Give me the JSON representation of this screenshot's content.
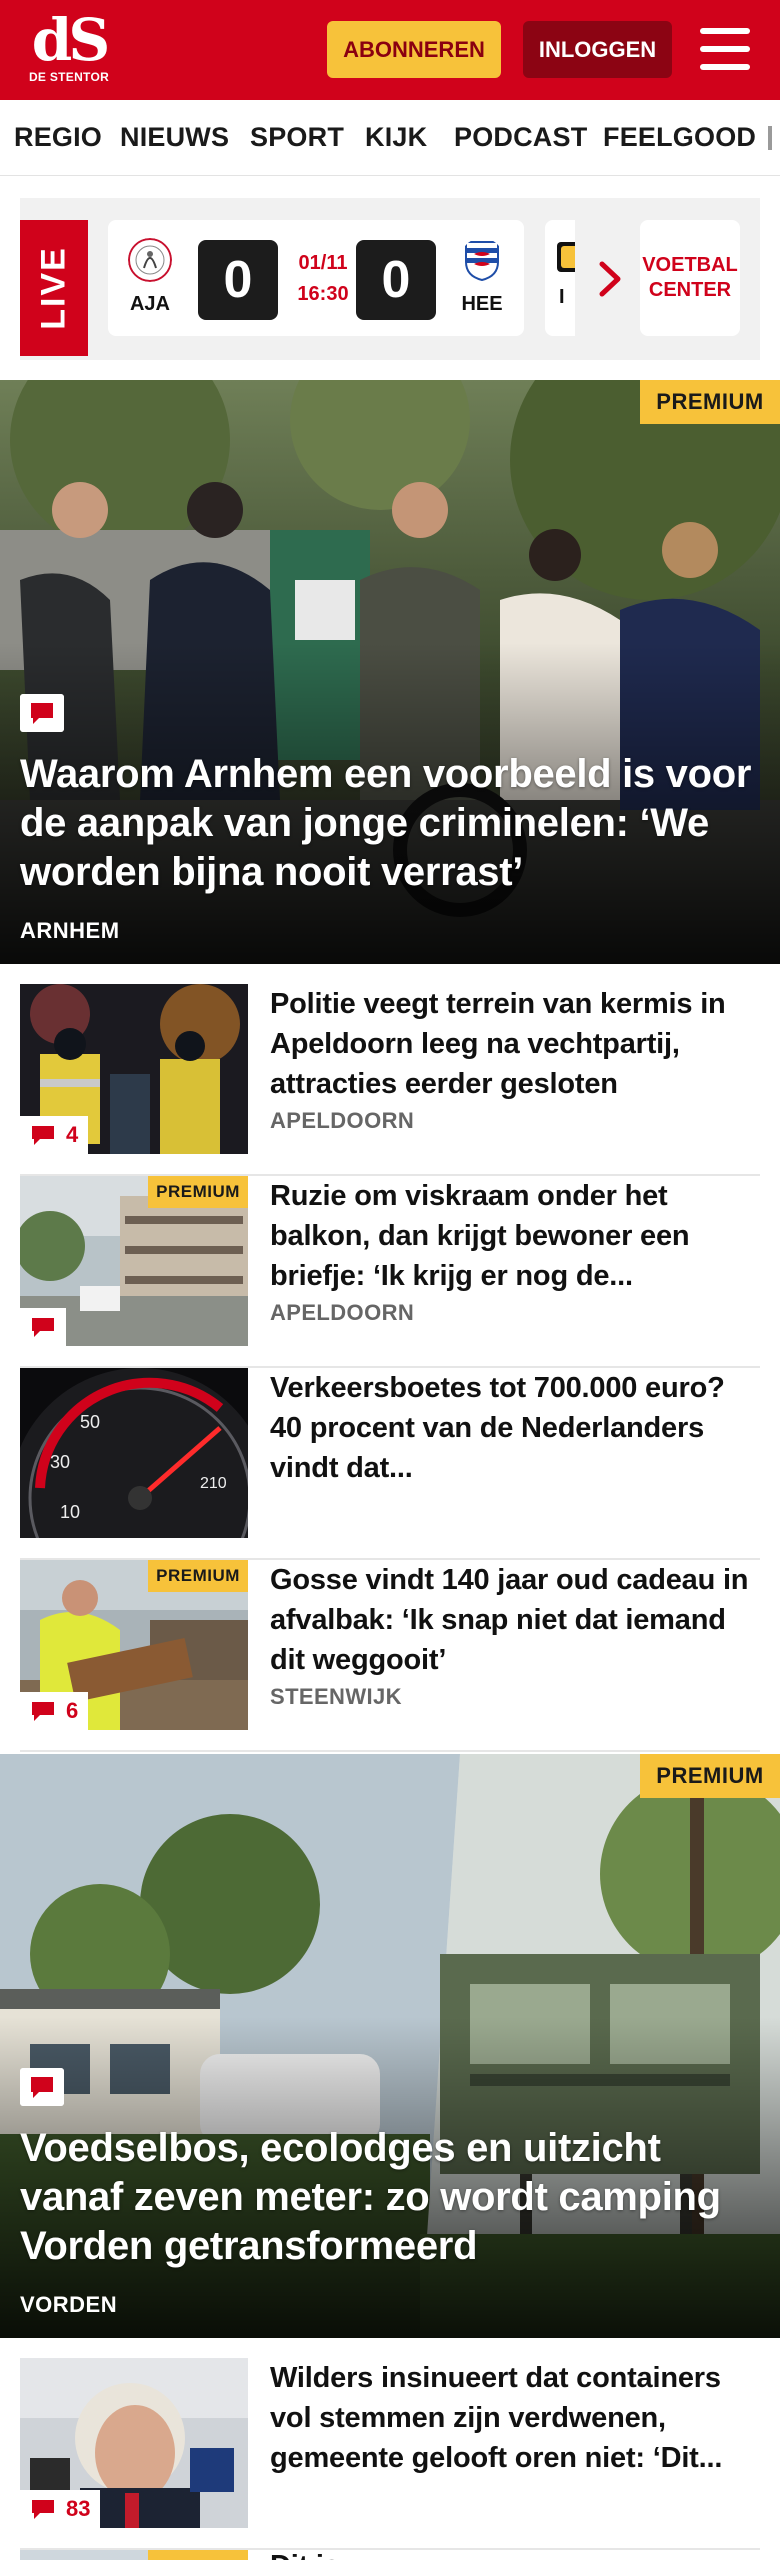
{
  "header": {
    "logo_mark": "dS",
    "logo_name": "DE STENTOR",
    "subscribe_label": "ABONNEREN",
    "login_label": "INLOGGEN",
    "brand_color": "#d0021b",
    "accent_color": "#f7c23a"
  },
  "nav": {
    "items": [
      "REGIO",
      "NIEUWS",
      "SPORT",
      "KIJK",
      "PODCAST",
      "FEELGOOD"
    ]
  },
  "live": {
    "label": "LIVE",
    "match": {
      "home": "AJA",
      "away": "HEE",
      "home_score": "0",
      "away_score": "0",
      "date": "01/11",
      "time": "16:30"
    },
    "next_team_fragment": "I",
    "voetbal_center": "VOETBAL CENTER"
  },
  "hero1": {
    "badge": "PREMIUM",
    "title": "Waarom Arnhem een voorbeeld is voor de aanpak van jonge criminelen: ‘We worden bijna nooit verrast’",
    "region": "ARNHEM",
    "icon": "comment-icon"
  },
  "articles": [
    {
      "title": "Politie veegt terrein van kermis in Apeldoorn leeg na vechtpartij, attracties eerder gesloten",
      "region": "APELDOORN",
      "comments": "4",
      "premium": ""
    },
    {
      "title": "Ruzie om viskraam onder het balkon, dan krijgt bewoner een briefje: ‘Ik krijg er nog de...",
      "region": "APELDOORN",
      "comments": "",
      "premium": "PREMIUM"
    },
    {
      "title": "Verkeersboetes tot 700.000 euro? 40 procent van de Nederlanders vindt dat...",
      "region": "",
      "comments": "",
      "premium": ""
    },
    {
      "title": "Gosse vindt 140 jaar oud cadeau in afvalbak: ‘Ik snap niet dat iemand dit weggooit’",
      "region": "STEENWIJK",
      "comments": "6",
      "premium": "PREMIUM"
    }
  ],
  "hero2": {
    "badge": "PREMIUM",
    "title": "Voedselbos, ecolodges en uitzicht vanaf zeven meter: zo wordt camping Vorden getransformeerd",
    "region": "VORDEN",
    "icon": "comment-icon"
  },
  "articles2": [
    {
      "title": "Wilders insinueert dat containers vol stemmen zijn verdwenen, gemeente gelooft oren niet: ‘Dit...",
      "region": "",
      "comments": "83",
      "premium": ""
    },
    {
      "title": "Dit is",
      "region": "",
      "comments": "",
      "premium": "PREMIUM"
    }
  ]
}
